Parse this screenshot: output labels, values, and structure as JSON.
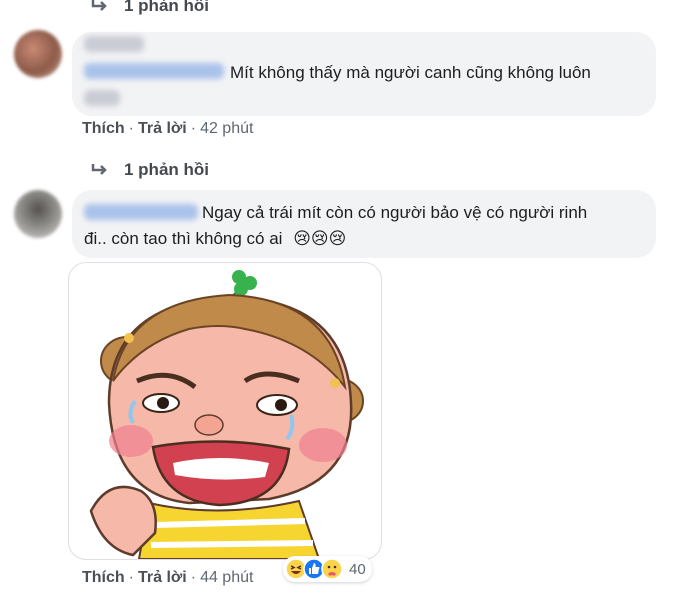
{
  "thread": {
    "reply_link_1": "1 phản hồi",
    "reply_link_2": "1 phản hồi"
  },
  "comments": [
    {
      "text": "Mít không thấy mà người canh cũng không luôn",
      "actions": {
        "like": "Thích",
        "reply": "Trả lời",
        "time": "42 phút"
      }
    },
    {
      "text_line1": "Ngay cả trái mít còn có người bảo vệ có người rinh",
      "text_line2": "đi.. còn tao thì không có ai",
      "emoji": "😢😢😢",
      "actions": {
        "like": "Thích",
        "reply": "Trả lời",
        "time": "44 phút"
      },
      "reactions": {
        "icons": [
          "haha-icon",
          "like-icon",
          "care-icon"
        ],
        "count": "40"
      }
    }
  ],
  "colors": {
    "bubble": "#f2f3f5",
    "action_text": "#4b4f56",
    "like_blue": "#1877f2",
    "sticker_shirt": "#f7d531"
  }
}
